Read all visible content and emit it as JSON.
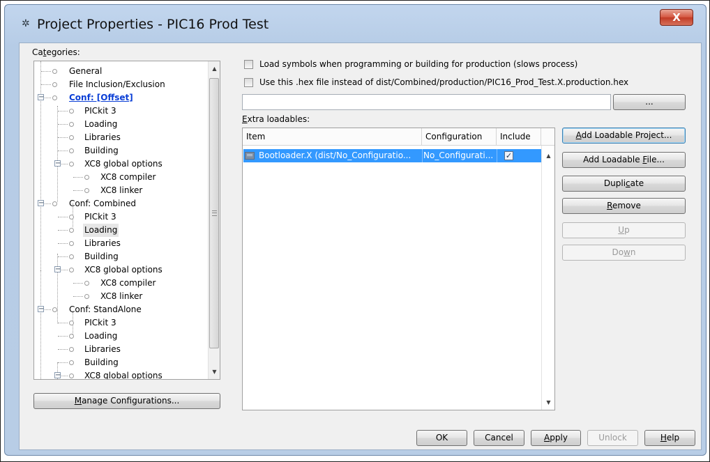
{
  "window": {
    "title": "Project Properties - PIC16 Prod Test",
    "close_label": "X",
    "app_icon": "gear-icon"
  },
  "categories": {
    "label_prefix": "Ca",
    "label_mnemonic": "t",
    "label_suffix": "egories:",
    "tree": [
      {
        "label": "General"
      },
      {
        "label": "File Inclusion/Exclusion"
      },
      {
        "label": "Conf: [Offset]",
        "active": true
      },
      {
        "label": "PICkit 3"
      },
      {
        "label": "Loading"
      },
      {
        "label": "Libraries"
      },
      {
        "label": "Building"
      },
      {
        "label": "XC8 global options"
      },
      {
        "label": "XC8 compiler"
      },
      {
        "label": "XC8 linker"
      },
      {
        "label": "Conf: Combined"
      },
      {
        "label": "PICkit 3"
      },
      {
        "label": "Loading",
        "selected": true
      },
      {
        "label": "Libraries"
      },
      {
        "label": "Building"
      },
      {
        "label": "XC8 global options"
      },
      {
        "label": "XC8 compiler"
      },
      {
        "label": "XC8 linker"
      },
      {
        "label": "Conf: StandAlone"
      },
      {
        "label": "PICkit 3"
      },
      {
        "label": "Loading"
      },
      {
        "label": "Libraries"
      },
      {
        "label": "Building"
      },
      {
        "label": "XC8 global options"
      }
    ],
    "manage_prefix": "M",
    "manage_suffix": "anage Configurations..."
  },
  "options": {
    "load_symbols_label": "Load symbols when programming or building for production (slows process)",
    "use_hex_label": "Use this .hex file instead of dist/Combined/production/PIC16_Prod_Test.X.production.hex",
    "hex_path_value": "",
    "browse_label": "..."
  },
  "loadables": {
    "label_mnemonic": "E",
    "label_suffix": "xtra loadables:",
    "columns": [
      "Item",
      "Configuration",
      "Include"
    ],
    "rows": [
      {
        "item": "Bootloader.X (dist/No_Configuratio...",
        "configuration": "No_Configurati...",
        "include": true
      }
    ]
  },
  "side_buttons": {
    "add_project": {
      "pre": "",
      "mn": "A",
      "post": "dd Loadable Project..."
    },
    "add_file": {
      "pre": "Add Loadable ",
      "mn": "F",
      "post": "ile..."
    },
    "duplicate": {
      "pre": "Dupli",
      "mn": "c",
      "post": "ate"
    },
    "remove": {
      "pre": "",
      "mn": "R",
      "post": "emove"
    },
    "up": {
      "pre": "",
      "mn": "U",
      "post": "p"
    },
    "down": {
      "pre": "Do",
      "mn": "w",
      "post": "n"
    }
  },
  "footer": {
    "ok": "OK",
    "cancel": "Cancel",
    "apply_mn": "A",
    "apply_rest": "pply",
    "unlock": "Unlock",
    "help_mn": "H",
    "help_rest": "elp"
  }
}
